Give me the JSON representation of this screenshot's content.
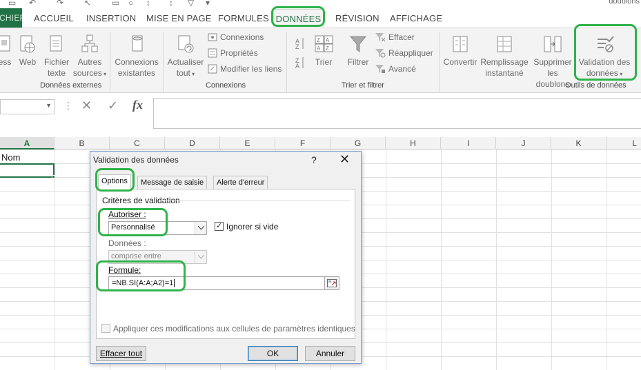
{
  "window": {
    "doc_title": "doublons"
  },
  "ribbon_tabs": [
    "FICHIER",
    "ACCUEIL",
    "INSERTION",
    "MISE EN PAGE",
    "FORMULES",
    "DONNÉES",
    "RÉVISION",
    "AFFICHAGE"
  ],
  "ribbon": {
    "external": {
      "access_label": "ess",
      "web_label": "Web",
      "text_file_label_1": "Fichier",
      "text_file_label_2": "texte",
      "other_label_1": "Autres",
      "other_label_2": "sources",
      "existing_label_1": "Connexions",
      "existing_label_2": "existantes",
      "group_label": "Données externes"
    },
    "connections": {
      "refresh_label_1": "Actualiser",
      "refresh_label_2": "tout",
      "connections_label": "Connexions",
      "properties_label": "Propriétés",
      "edit_links_label": "Modifier les liens",
      "group_label": "Connexions"
    },
    "sort_filter": {
      "sort_label": "Trier",
      "filter_label": "Filtrer",
      "clear_label": "Effacer",
      "reapply_label": "Réappliquer",
      "advanced_label": "Avancé",
      "group_label": "Trier et filtrer"
    },
    "data_tools": {
      "convert_label": "Convertir",
      "flash_fill_label_1": "Remplissage",
      "flash_fill_label_2": "instantané",
      "remove_dup_label_1": "Supprimer",
      "remove_dup_label_2": "les doublons",
      "validation_label_1": "Validation des",
      "validation_label_2": "données",
      "group_label": "Outils de données"
    }
  },
  "formula_bar": {
    "name_box": "",
    "cancel_symbol": "✕",
    "enter_symbol": "✓",
    "fx_symbol": "fx",
    "content": ""
  },
  "sheet": {
    "columns": [
      "A",
      "B",
      "C",
      "D",
      "E",
      "F",
      "G",
      "H",
      "I",
      "J",
      "K",
      "L"
    ],
    "cells": {
      "A1": "Nom"
    }
  },
  "dialog": {
    "title": "Validation des données",
    "help": "?",
    "close": "✕",
    "tabs": [
      "Options",
      "Message de saisie",
      "Alerte d'erreur"
    ],
    "criteria_title": "Critères de validation",
    "allow_label": "Autoriser :",
    "allow_value": "Personnalisé",
    "ignore_blank_label": "Ignorer si vide",
    "ignore_blank_checked": true,
    "data_label": "Données :",
    "data_value": "comprise entre",
    "formula_label": "Formule:",
    "formula_value": "=NB.SI(A:A;A2)=1",
    "apply_all_label": "Appliquer ces modifications aux cellules de paramètres identiques",
    "apply_all_checked": false,
    "clear_all": "Effacer tout",
    "ok": "OK",
    "cancel": "Annuler"
  },
  "colors": {
    "excel_green": "#217346",
    "highlight_green": "#2eb34a"
  }
}
